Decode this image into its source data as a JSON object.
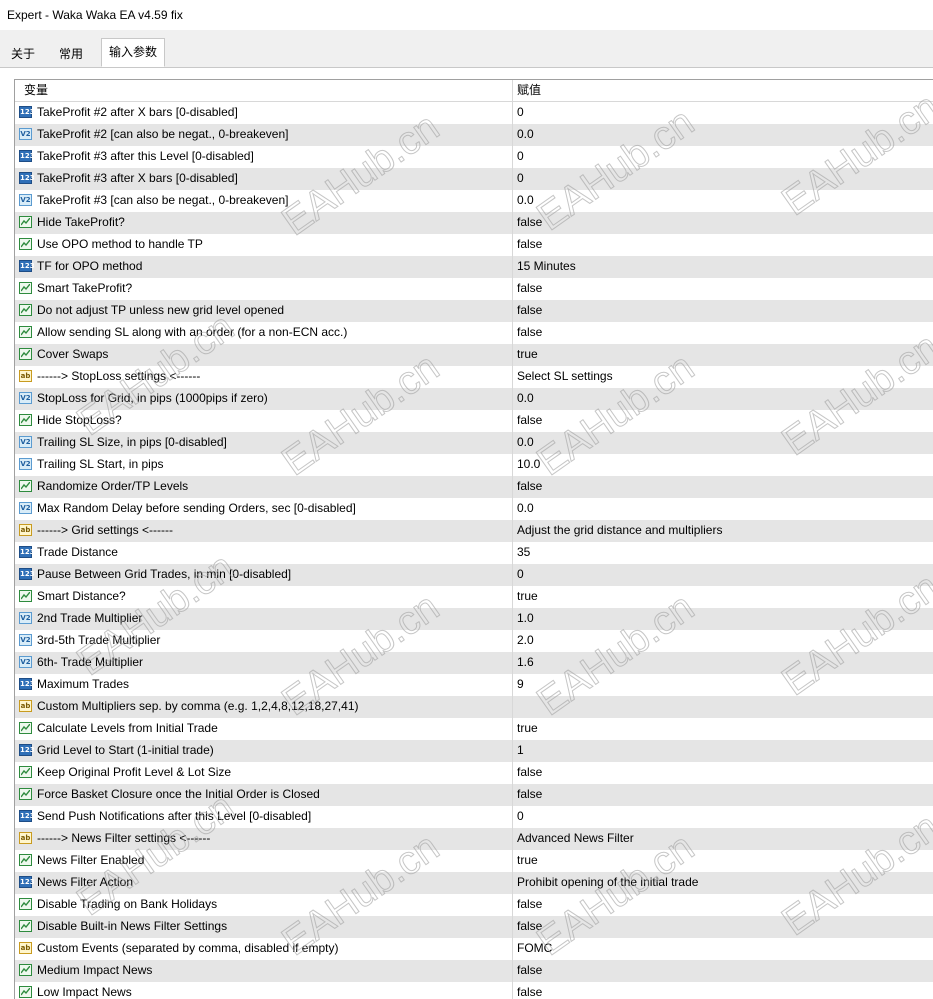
{
  "window": {
    "title": "Expert - Waka Waka EA v4.59 fix"
  },
  "tabs": [
    {
      "label": "关于"
    },
    {
      "label": "常用"
    },
    {
      "label": "输入参数"
    }
  ],
  "table": {
    "headers": {
      "variable": "变量",
      "value": "赋值"
    },
    "rows": [
      {
        "type": "int",
        "name": "TakeProfit #2 after X bars [0-disabled]",
        "value": "0"
      },
      {
        "type": "double",
        "name": "TakeProfit #2 [can also be negat., 0-breakeven]",
        "value": "0.0"
      },
      {
        "type": "int",
        "name": "TakeProfit #3 after this Level [0-disabled]",
        "value": "0"
      },
      {
        "type": "int",
        "name": "TakeProfit #3 after X bars [0-disabled]",
        "value": "0"
      },
      {
        "type": "double",
        "name": "TakeProfit #3 [can also be negat., 0-breakeven]",
        "value": "0.0"
      },
      {
        "type": "bool",
        "name": "Hide TakeProfit?",
        "value": "false"
      },
      {
        "type": "bool",
        "name": "Use OPO method to handle TP",
        "value": "false"
      },
      {
        "type": "int",
        "name": "TF for OPO method",
        "value": "15 Minutes"
      },
      {
        "type": "bool",
        "name": "Smart TakeProfit?",
        "value": "false"
      },
      {
        "type": "bool",
        "name": "Do not adjust TP unless new grid level opened",
        "value": "false"
      },
      {
        "type": "bool",
        "name": "Allow sending SL along with an order (for a non-ECN acc.)",
        "value": "false"
      },
      {
        "type": "bool",
        "name": "Cover Swaps",
        "value": "true"
      },
      {
        "type": "string",
        "name": "------> StopLoss settings <------",
        "value": "Select SL settings"
      },
      {
        "type": "double",
        "name": "StopLoss for Grid, in pips (1000pips if zero)",
        "value": "0.0"
      },
      {
        "type": "bool",
        "name": "Hide StopLoss?",
        "value": "false"
      },
      {
        "type": "double",
        "name": "Trailing SL Size, in pips [0-disabled]",
        "value": "0.0"
      },
      {
        "type": "double",
        "name": "Trailing SL Start, in pips",
        "value": "10.0"
      },
      {
        "type": "bool",
        "name": "Randomize Order/TP Levels",
        "value": "false"
      },
      {
        "type": "double",
        "name": "Max Random Delay before sending Orders, sec [0-disabled]",
        "value": "0.0"
      },
      {
        "type": "string",
        "name": "------> Grid settings <------",
        "value": "Adjust the grid distance and multipliers"
      },
      {
        "type": "int",
        "name": "Trade Distance",
        "value": "35"
      },
      {
        "type": "int",
        "name": "Pause Between Grid Trades, in min [0-disabled]",
        "value": "0"
      },
      {
        "type": "bool",
        "name": "Smart Distance?",
        "value": "true"
      },
      {
        "type": "double",
        "name": "2nd Trade Multiplier",
        "value": "1.0"
      },
      {
        "type": "double",
        "name": "3rd-5th Trade Multiplier",
        "value": "2.0"
      },
      {
        "type": "double",
        "name": "6th- Trade Multiplier",
        "value": "1.6"
      },
      {
        "type": "int",
        "name": "Maximum Trades",
        "value": "9"
      },
      {
        "type": "string",
        "name": "Custom Multipliers sep. by comma (e.g. 1,2,4,8,12,18,27,41)",
        "value": ""
      },
      {
        "type": "bool",
        "name": "Calculate Levels from Initial Trade",
        "value": "true"
      },
      {
        "type": "int",
        "name": "Grid Level to Start (1-initial trade)",
        "value": "1"
      },
      {
        "type": "bool",
        "name": "Keep Original Profit Level & Lot Size",
        "value": "false"
      },
      {
        "type": "bool",
        "name": "Force Basket Closure once the Initial Order is Closed",
        "value": "false"
      },
      {
        "type": "int",
        "name": "Send Push Notifications after this Level [0-disabled]",
        "value": "0"
      },
      {
        "type": "string",
        "name": "------> News Filter settings <------",
        "value": "Advanced News Filter"
      },
      {
        "type": "bool",
        "name": "News Filter Enabled",
        "value": "true"
      },
      {
        "type": "int",
        "name": "News Filter Action",
        "value": "Prohibit opening of the initial trade"
      },
      {
        "type": "bool",
        "name": "Disable Trading on Bank Holidays",
        "value": "false"
      },
      {
        "type": "bool",
        "name": "Disable Built-in News Filter Settings",
        "value": "false"
      },
      {
        "type": "string",
        "name": "Custom Events (separated by comma, disabled if empty)",
        "value": "FOMC"
      },
      {
        "type": "bool",
        "name": "Medium Impact News",
        "value": "false"
      },
      {
        "type": "bool",
        "name": "Low Impact News",
        "value": "false"
      }
    ]
  },
  "icons": {
    "int": {
      "name": "int-type-icon",
      "glyph": "123"
    },
    "double": {
      "name": "double-type-icon",
      "glyph": "V2"
    },
    "bool": {
      "name": "bool-type-icon",
      "glyph": ""
    },
    "string": {
      "name": "string-type-icon",
      "glyph": "ab"
    }
  },
  "watermark": {
    "text": "EAHub.cn"
  }
}
